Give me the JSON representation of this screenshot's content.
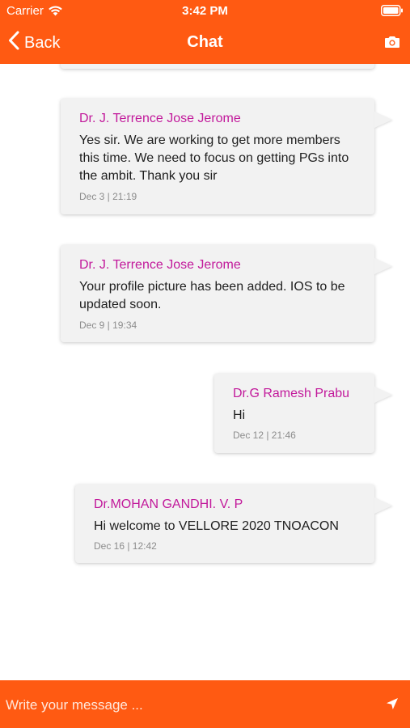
{
  "status_bar": {
    "carrier": "Carrier",
    "time": "3:42 PM"
  },
  "nav": {
    "back_label": "Back",
    "title": "Chat"
  },
  "messages": [
    {
      "sender": "Dr. J. Terrence Jose Jerome",
      "text": "Yes sir. We are working to get more members this time. We need to focus on getting PGs into the ambit. Thank you sir",
      "meta": "Dec 3 | 21:19"
    },
    {
      "sender": "Dr. J. Terrence Jose Jerome",
      "text": "Your profile picture has been added. IOS to be updated soon.",
      "meta": "Dec 9 | 19:34"
    },
    {
      "sender": "Dr.G Ramesh Prabu",
      "text": "Hi",
      "meta": "Dec 12 | 21:46"
    },
    {
      "sender": "Dr.MOHAN GANDHI. V. P",
      "text": "Hi welcome to VELLORE 2020 TNOACON",
      "meta": "Dec 16 | 12:42"
    }
  ],
  "compose": {
    "placeholder": "Write your message ..."
  },
  "colors": {
    "brand": "#ff5a12",
    "sender": "#c2199b",
    "bubble": "#f2f2f2"
  },
  "icons": {
    "wifi": "wifi-icon",
    "battery": "battery-icon",
    "back": "chevron-left-icon",
    "camera": "camera-icon",
    "send": "send-icon"
  }
}
